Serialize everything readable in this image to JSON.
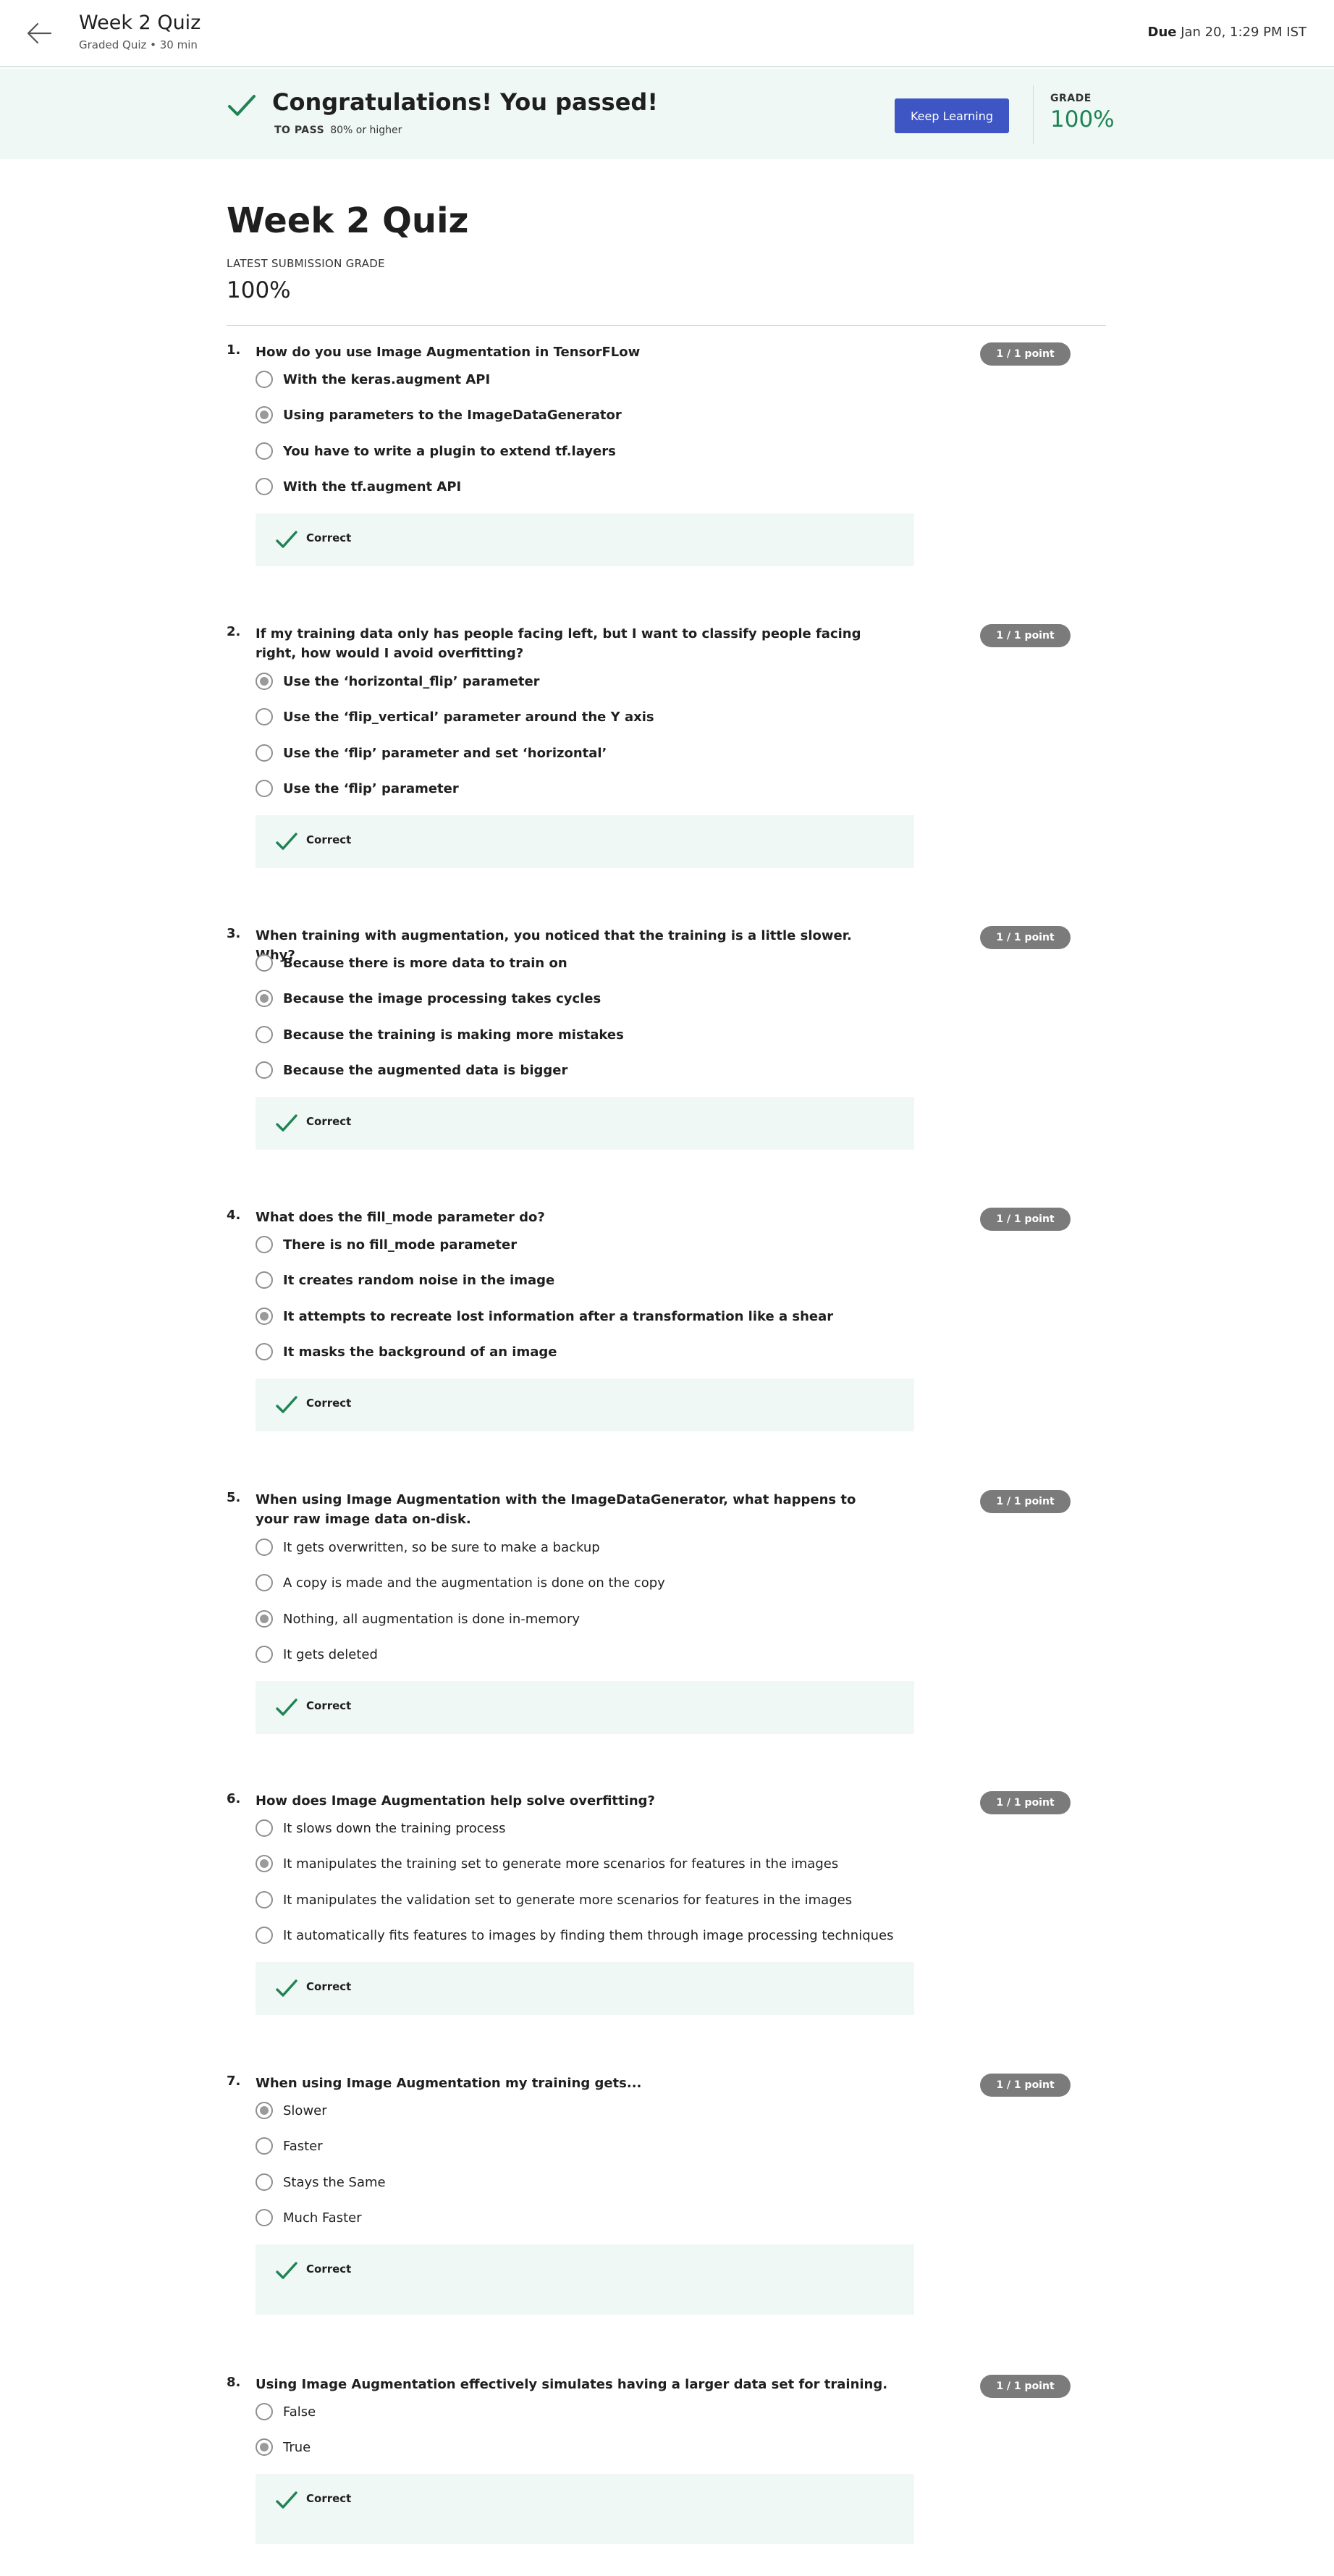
{
  "header": {
    "title": "Week 2 Quiz",
    "subtitle": "Graded Quiz • 30 min",
    "due_label": "Due",
    "due_value": "Jan 20, 1:29 PM IST"
  },
  "banner": {
    "headline": "Congratulations! You passed!",
    "to_pass_label": "TO PASS",
    "to_pass_value": "80% or higher",
    "button_label": "Keep Learning",
    "grade_label": "GRADE",
    "grade_value": "100%"
  },
  "main": {
    "title": "Week 2 Quiz",
    "latest_label": "LATEST SUBMISSION GRADE",
    "latest_value": "100%"
  },
  "colors": {
    "accent": "#3d56c4",
    "success": "#1f8354",
    "banner_bg": "#eff8f5",
    "points_badge": "#7b7b7b"
  },
  "questions": [
    {
      "number": "1.",
      "text": "How do you use Image Augmentation in TensorFLow",
      "points": "1 / 1 point",
      "options": [
        "With the keras.augment API",
        "Using parameters to the ImageDataGenerator",
        "You have to write a plugin to extend tf.layers",
        "With the tf.augment API"
      ],
      "selected": 1,
      "feedback": "Correct"
    },
    {
      "number": "2.",
      "text": "If my training data only has people facing left, but I want to classify people facing right, how would I avoid overfitting?",
      "points": "1 / 1 point",
      "options": [
        "Use the ‘horizontal_flip’ parameter",
        "Use the ‘flip_vertical’ parameter around the Y axis",
        "Use the ‘flip’ parameter and set ‘horizontal’",
        "Use the ‘flip’ parameter"
      ],
      "selected": 0,
      "feedback": "Correct"
    },
    {
      "number": "3.",
      "text": "When training with augmentation, you noticed that the training is a little slower. Why?",
      "points": "1 / 1 point",
      "options": [
        "Because there is more data to train on",
        "Because the image processing takes cycles",
        "Because the training is making more mistakes",
        "Because the augmented data is bigger"
      ],
      "selected": 1,
      "feedback": "Correct"
    },
    {
      "number": "4.",
      "text": "What does the fill_mode parameter do?",
      "points": "1 / 1 point",
      "options": [
        "There is no fill_mode parameter",
        "It creates random noise in the image",
        "It attempts to recreate lost information after a transformation like a shear",
        "It masks the background of an image"
      ],
      "selected": 2,
      "feedback": "Correct"
    },
    {
      "number": "5.",
      "text": "When using Image Augmentation with the ImageDataGenerator, what happens to your raw image data on-disk.",
      "points": "1 / 1 point",
      "options": [
        "It gets overwritten, so be sure to make a backup",
        "A copy is made and the augmentation is done on the copy",
        "Nothing, all augmentation is done in-memory",
        "It gets deleted"
      ],
      "selected": 2,
      "feedback": "Correct"
    },
    {
      "number": "6.",
      "text": "How does Image Augmentation help solve overfitting?",
      "points": "1 / 1 point",
      "options": [
        "It slows down the training process",
        "It manipulates the training set to generate more scenarios for features in the images",
        "It manipulates the validation set to generate more scenarios for features in the images",
        "It automatically fits features to images by finding them through image processing techniques"
      ],
      "selected": 1,
      "feedback": "Correct"
    },
    {
      "number": "7.",
      "text": "When using Image Augmentation my training gets...",
      "points": "1 / 1 point",
      "options": [
        "Slower",
        "Faster",
        "Stays the Same",
        "Much Faster"
      ],
      "selected": 0,
      "feedback": "Correct"
    },
    {
      "number": "8.",
      "text": "Using Image Augmentation effectively simulates having a larger data set for training.",
      "points": "1 / 1 point",
      "options": [
        "False",
        "True"
      ],
      "selected": 1,
      "feedback": "Correct"
    }
  ]
}
